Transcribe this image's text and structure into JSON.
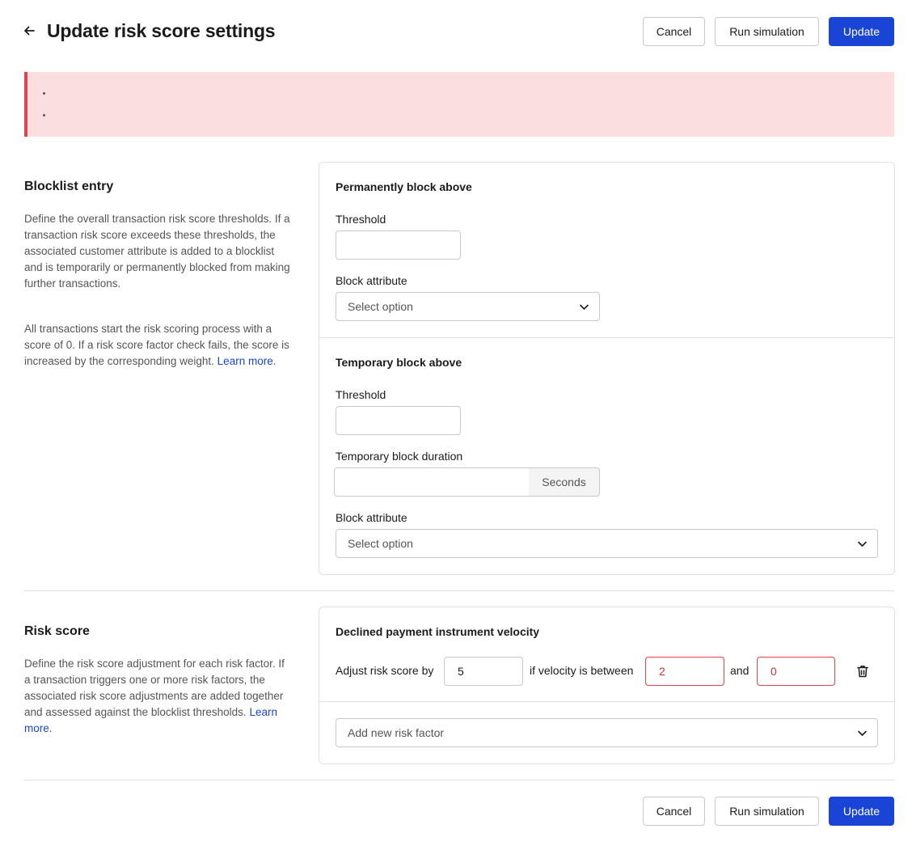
{
  "header": {
    "back_icon": "arrow-left-icon",
    "title": "Update risk score settings",
    "cancel_label": "Cancel",
    "simulate_label": "Run simulation",
    "update_label": "Update"
  },
  "error_banner": {
    "bullets": [
      "",
      ""
    ],
    "color": "#fbdfdf",
    "accent": "#e0434b"
  },
  "blocklist": {
    "title": "Blocklist entry",
    "desc1": "Define the overall transaction risk score thresholds. If a transaction risk score exceeds these thresholds, the associated customer attribute is added to a blocklist and is temporarily or permanently blocked from making further transactions.",
    "desc2_text": "All transactions start the risk scoring process with a score of 0. If a risk score factor check fails, the score is increased by the corresponding weight.",
    "desc2_link": "Learn more",
    "permanent": {
      "title": "Permanently block above",
      "threshold_label": "Threshold",
      "threshold_value": "",
      "attribute_label": "Block attribute",
      "attribute_placeholder": "Select option"
    },
    "temporary": {
      "title": "Temporary block above",
      "threshold_label": "Threshold",
      "threshold_value": "",
      "duration_label": "Temporary block duration",
      "duration_value": "",
      "duration_unit": "Seconds",
      "attribute_label": "Block attribute",
      "attribute_placeholder": "Select option"
    }
  },
  "risk_score": {
    "title": "Risk score",
    "desc_text": "Define the risk score adjustment for each risk factor. If a transaction triggers one or more risk factors, the associated risk score adjustments are added together and assessed against the blocklist thresholds.",
    "desc_link": "Learn more",
    "factor": {
      "title": "Declined payment instrument velocity",
      "adjust_label": "Adjust risk score by",
      "adjust_value": "5",
      "between_label": "if velocity is between",
      "min_value": "2",
      "and_label": "and",
      "max_value": "0"
    },
    "add_factor_placeholder": "Add new risk factor"
  },
  "footer": {
    "cancel_label": "Cancel",
    "simulate_label": "Run simulation",
    "update_label": "Update"
  },
  "colors": {
    "primary": "#1a44d6",
    "error": "#e0434b",
    "link": "#1a44d6"
  }
}
